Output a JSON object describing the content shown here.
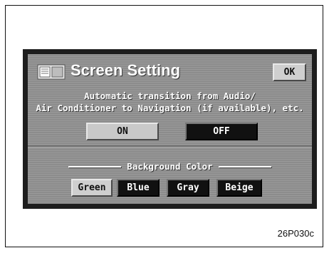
{
  "window": {
    "title": "Screen Setting",
    "ok_label": "OK",
    "icon": "screen-setting-icon"
  },
  "transition": {
    "description_line1": "Automatic transition from Audio/",
    "description_line2": "Air Conditioner to Navigation (if available), etc.",
    "on_label": "ON",
    "off_label": "OFF",
    "selected": "OFF"
  },
  "background": {
    "heading": "Background Color",
    "options": [
      "Green",
      "Blue",
      "Gray",
      "Beige"
    ],
    "selected": "Green"
  },
  "caption": "26P030c"
}
